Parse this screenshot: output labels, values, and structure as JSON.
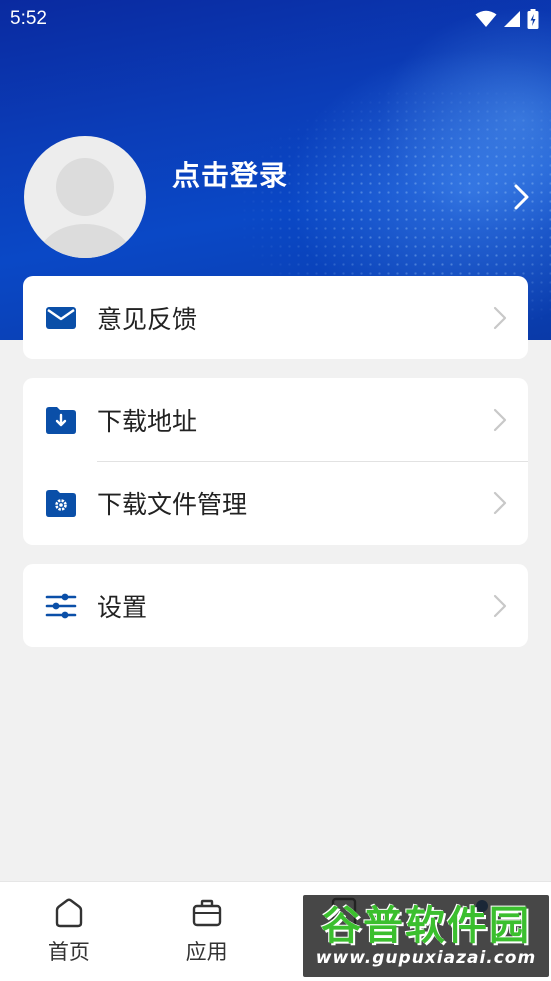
{
  "status_bar": {
    "time": "5:52",
    "icons": [
      "wifi-icon",
      "signal-icon",
      "battery-charging-icon"
    ]
  },
  "profile": {
    "login_label": "点击登录"
  },
  "menu": {
    "feedback": {
      "label": "意见反馈",
      "icon": "envelope-icon"
    },
    "download_address": {
      "label": "下载地址",
      "icon": "folder-download-icon"
    },
    "download_manager": {
      "label": "下载文件管理",
      "icon": "folder-gear-icon"
    },
    "settings": {
      "label": "设置",
      "icon": "sliders-icon"
    }
  },
  "bottom_nav": {
    "items": [
      {
        "label": "首页",
        "icon": "home-icon"
      },
      {
        "label": "应用",
        "icon": "briefcase-icon"
      },
      {
        "label": "",
        "icon": "book-icon"
      },
      {
        "label": "",
        "icon": "user-icon"
      }
    ]
  },
  "watermark": {
    "title": "谷普软件园",
    "url": "www.gupuxiazai.com"
  },
  "colors": {
    "accent": "#0a4fa8",
    "header_dark": "#0a2aa0",
    "header_light": "#0a48c6",
    "background": "#f1f1f1",
    "watermark_green": "#3bbf2e"
  }
}
